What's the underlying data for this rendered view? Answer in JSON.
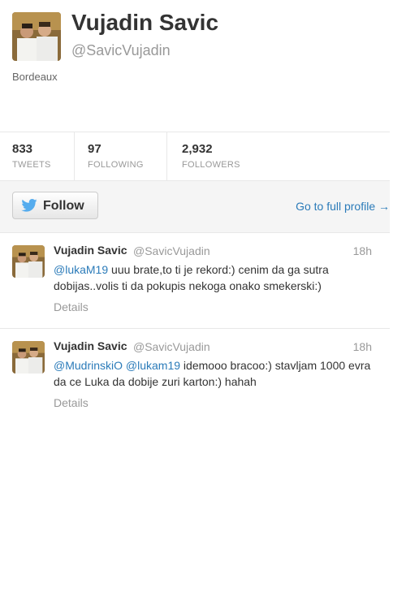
{
  "profile": {
    "name": "Vujadin Savic",
    "handle": "@SavicVujadin",
    "location": "Bordeaux"
  },
  "stats": [
    {
      "value": "833",
      "label": "TWEETS"
    },
    {
      "value": "97",
      "label": "FOLLOWING"
    },
    {
      "value": "2,932",
      "label": "FOLLOWERS"
    }
  ],
  "actions": {
    "follow_label": "Follow",
    "full_profile_label": "Go to full profile →"
  },
  "tweets": [
    {
      "name": "Vujadin Savic",
      "handle": "@SavicVujadin",
      "time": "18h",
      "mentions": [
        "@lukaM19"
      ],
      "text": " uuu brate,to ti je rekord:) cenim da ga sutra dobijas..volis ti da pokupis nekoga onako smekerski:)",
      "details": "Details"
    },
    {
      "name": "Vujadin Savic",
      "handle": "@SavicVujadin",
      "time": "18h",
      "mentions": [
        "@MudrinskiO",
        "@lukam19"
      ],
      "text": " idemooo bracoo:) stavljam 1000 evra da ce Luka da dobije zuri karton:) hahah",
      "details": "Details"
    }
  ],
  "colors": {
    "link": "#2b7bb9",
    "twitter_blue": "#55acee",
    "muted": "#999999"
  },
  "icons": {
    "follow": "twitter-bird-icon"
  }
}
